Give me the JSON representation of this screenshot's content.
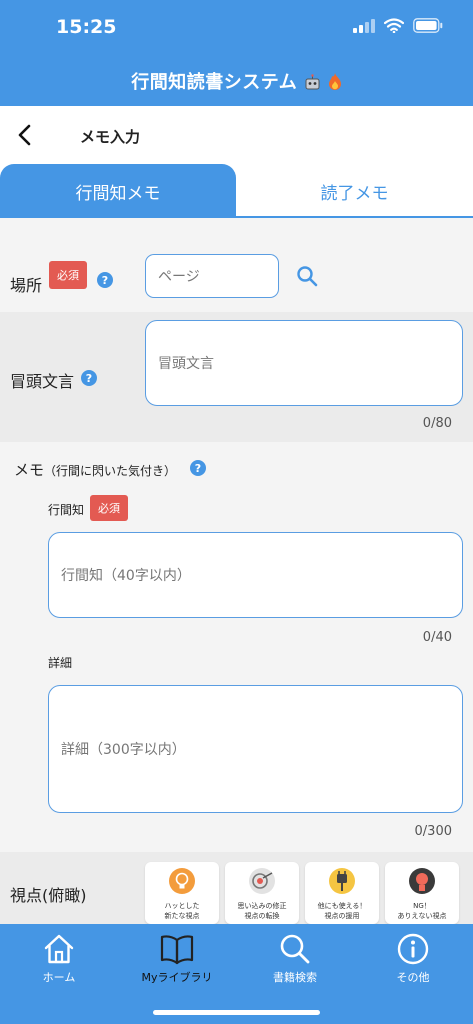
{
  "status_bar": {
    "time": "15:25"
  },
  "app": {
    "title": "行間知読書システム"
  },
  "subheader": {
    "title": "メモ入力"
  },
  "tabs": [
    {
      "label": "行間知メモ",
      "active": true
    },
    {
      "label": "読了メモ",
      "active": false
    }
  ],
  "place": {
    "label": "場所",
    "badge": "必須",
    "help": "?",
    "input_placeholder": "ページ"
  },
  "opening": {
    "label": "冒頭文言",
    "help": "?",
    "placeholder": "冒頭文言",
    "counter": "0/80"
  },
  "memo": {
    "label": "メモ",
    "sublabel": "（行間に閃いた気付き）",
    "help": "?",
    "insight": {
      "label": "行間知",
      "badge": "必須",
      "placeholder": "行間知（40字以内）",
      "counter": "0/40"
    },
    "detail": {
      "label": "詳細",
      "placeholder": "詳細（300字以内）",
      "counter": "0/300"
    }
  },
  "viewpoint": {
    "label": "視点(俯瞰)",
    "cards": [
      {
        "line1": "ハッとした",
        "line2": "新たな視点",
        "icon": "lightbulb-icon"
      },
      {
        "line1": "思い込みの修正",
        "line2": "視点の転換",
        "icon": "target-icon"
      },
      {
        "line1": "他にも使える！",
        "line2": "視点の援用",
        "icon": "plug-icon"
      },
      {
        "line1": "NG！",
        "line2": "ありえない視点",
        "icon": "ng-head-icon"
      }
    ]
  },
  "tabbar": {
    "items": [
      {
        "label": "ホーム",
        "icon": "home-icon"
      },
      {
        "label": "Myライブラリ",
        "icon": "book-icon"
      },
      {
        "label": "書籍検索",
        "icon": "search-icon"
      },
      {
        "label": "その他",
        "icon": "info-icon"
      }
    ]
  },
  "colors": {
    "primary": "#4596e4",
    "required_badge": "#e35a52",
    "input_border": "#5a9de2"
  }
}
